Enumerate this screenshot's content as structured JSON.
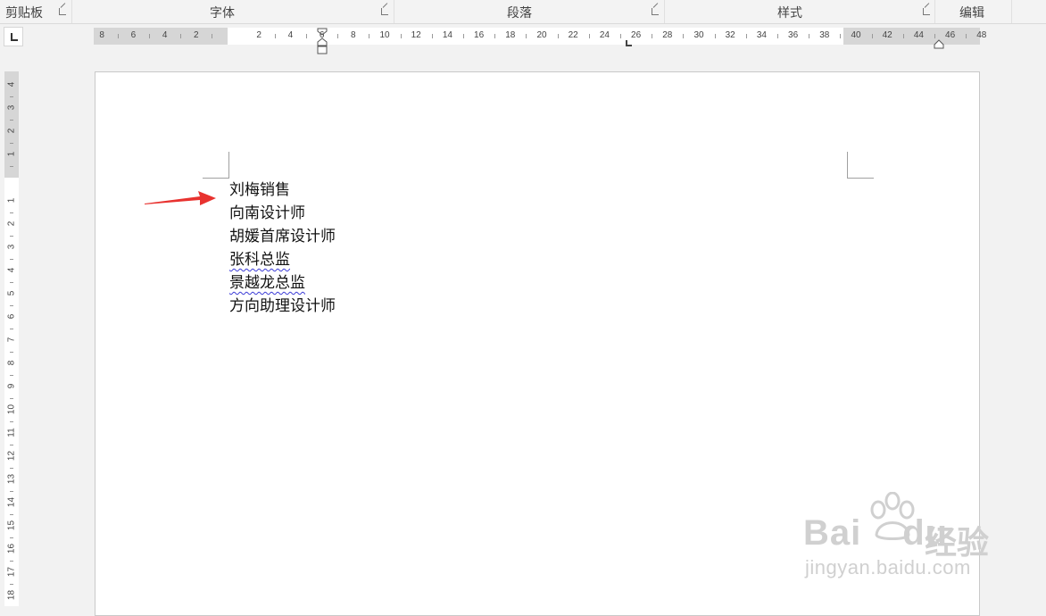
{
  "ribbon": {
    "groups": [
      {
        "label": "剪贴板"
      },
      {
        "label": "字体"
      },
      {
        "label": "段落"
      },
      {
        "label": "样式"
      },
      {
        "label": "编辑"
      }
    ]
  },
  "ruler": {
    "horizontal_numbers": [
      "8",
      "6",
      "4",
      "2",
      "2",
      "4",
      "6",
      "8",
      "10",
      "12",
      "14",
      "16",
      "18",
      "20",
      "22",
      "24",
      "26",
      "28",
      "30",
      "32",
      "34",
      "36",
      "38",
      "40",
      "42",
      "44",
      "46",
      "48"
    ],
    "vertical_numbers": [
      "4",
      "3",
      "2",
      "1",
      "1",
      "2",
      "3",
      "4",
      "5",
      "6",
      "7",
      "8",
      "9",
      "10",
      "11",
      "12",
      "13",
      "14",
      "15",
      "16",
      "17",
      "18"
    ]
  },
  "document": {
    "lines": [
      {
        "text": "刘梅销售",
        "spell_error": false
      },
      {
        "text": "向南设计师",
        "spell_error": false
      },
      {
        "text": "胡媛首席设计师",
        "spell_error": false
      },
      {
        "text": "张科总监",
        "spell_error": true
      },
      {
        "text": "景越龙总监",
        "spell_error": true
      },
      {
        "text": "方向助理设计师",
        "spell_error": false
      }
    ]
  },
  "annotation": {
    "arrow_color": "#e8322f"
  },
  "watermark": {
    "brand": "Bai",
    "brand2": "du",
    "cn": "经验",
    "url": "jingyan.baidu.com"
  }
}
